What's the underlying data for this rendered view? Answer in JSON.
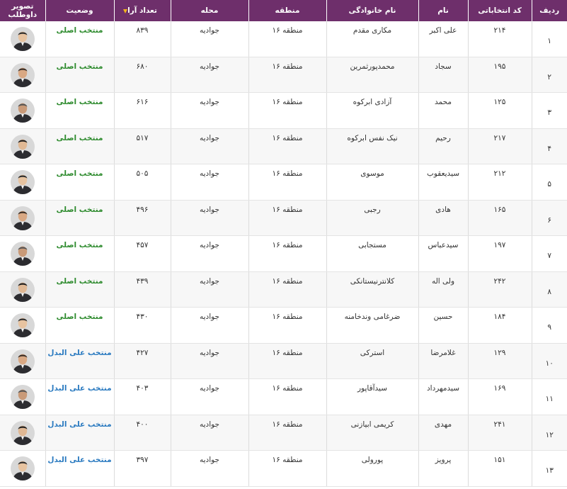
{
  "table": {
    "headers": {
      "row": "ردیف",
      "code": "کد انتخاباتی",
      "name": "نام",
      "family": "نام خانوادگی",
      "region": "منطقه",
      "neighborhood": "محله",
      "votes": "تعداد آرا",
      "status": "وضعیت",
      "photo": "تصویر داوطلب"
    },
    "sort_icon": "triangle-down-icon",
    "colors": {
      "header_bg": "#6e2f6b",
      "status_main": "#2e8b2e",
      "status_alt": "#2a7ac0",
      "sort_icon": "#f2b21b"
    },
    "rows": [
      {
        "row": "۱",
        "code": "۲۱۴",
        "name": "علی اکبر",
        "family": "مکاری مقدم",
        "region": "منطقه ۱۶",
        "neighborhood": "جوادیه",
        "votes": "۸۳۹",
        "status": "منتخب اصلی",
        "status_type": "main"
      },
      {
        "row": "۲",
        "code": "۱۹۵",
        "name": "سجاد",
        "family": "محمدپورثمرین",
        "region": "منطقه ۱۶",
        "neighborhood": "جوادیه",
        "votes": "۶۸۰",
        "status": "منتخب اصلی",
        "status_type": "main"
      },
      {
        "row": "۳",
        "code": "۱۲۵",
        "name": "محمد",
        "family": "آزادی ابرکوه",
        "region": "منطقه ۱۶",
        "neighborhood": "جوادیه",
        "votes": "۶۱۶",
        "status": "منتخب اصلی",
        "status_type": "main"
      },
      {
        "row": "۴",
        "code": "۲۱۷",
        "name": "رحیم",
        "family": "نیک نفس ابرکوه",
        "region": "منطقه ۱۶",
        "neighborhood": "جوادیه",
        "votes": "۵۱۷",
        "status": "منتخب اصلی",
        "status_type": "main"
      },
      {
        "row": "۵",
        "code": "۲۱۲",
        "name": "سیدیعقوب",
        "family": "موسوی",
        "region": "منطقه ۱۶",
        "neighborhood": "جوادیه",
        "votes": "۵۰۵",
        "status": "منتخب اصلی",
        "status_type": "main"
      },
      {
        "row": "۶",
        "code": "۱۶۵",
        "name": "هادی",
        "family": "رجبی",
        "region": "منطقه ۱۶",
        "neighborhood": "جوادیه",
        "votes": "۴۹۶",
        "status": "منتخب اصلی",
        "status_type": "main"
      },
      {
        "row": "۷",
        "code": "۱۹۷",
        "name": "سیدعباس",
        "family": "مستجابی",
        "region": "منطقه ۱۶",
        "neighborhood": "جوادیه",
        "votes": "۴۵۷",
        "status": "منتخب اصلی",
        "status_type": "main"
      },
      {
        "row": "۸",
        "code": "۲۴۲",
        "name": "ولی اله",
        "family": "کلانترنیستانکی",
        "region": "منطقه ۱۶",
        "neighborhood": "جوادیه",
        "votes": "۴۳۹",
        "status": "منتخب اصلی",
        "status_type": "main"
      },
      {
        "row": "۹",
        "code": "۱۸۴",
        "name": "حسین",
        "family": "ضرغامی وندخامنه",
        "region": "منطقه ۱۶",
        "neighborhood": "جوادیه",
        "votes": "۴۳۰",
        "status": "منتخب اصلی",
        "status_type": "main"
      },
      {
        "row": "۱۰",
        "code": "۱۲۹",
        "name": "غلامرضا",
        "family": "استرکی",
        "region": "منطقه ۱۶",
        "neighborhood": "جوادیه",
        "votes": "۴۲۷",
        "status": "منتخب علی البدل",
        "status_type": "alt"
      },
      {
        "row": "۱۱",
        "code": "۱۶۹",
        "name": "سیدمهرداد",
        "family": "سیدآقاپور",
        "region": "منطقه ۱۶",
        "neighborhood": "جوادیه",
        "votes": "۴۰۳",
        "status": "منتخب علی البدل",
        "status_type": "alt"
      },
      {
        "row": "۱۲",
        "code": "۲۴۱",
        "name": "مهدی",
        "family": "کریمی ابیازنی",
        "region": "منطقه ۱۶",
        "neighborhood": "جوادیه",
        "votes": "۴۰۰",
        "status": "منتخب علی البدل",
        "status_type": "alt"
      },
      {
        "row": "۱۳",
        "code": "۱۵۱",
        "name": "پرویز",
        "family": "پورولی",
        "region": "منطقه ۱۶",
        "neighborhood": "جوادیه",
        "votes": "۳۹۷",
        "status": "منتخب علی البدل",
        "status_type": "alt"
      }
    ]
  }
}
